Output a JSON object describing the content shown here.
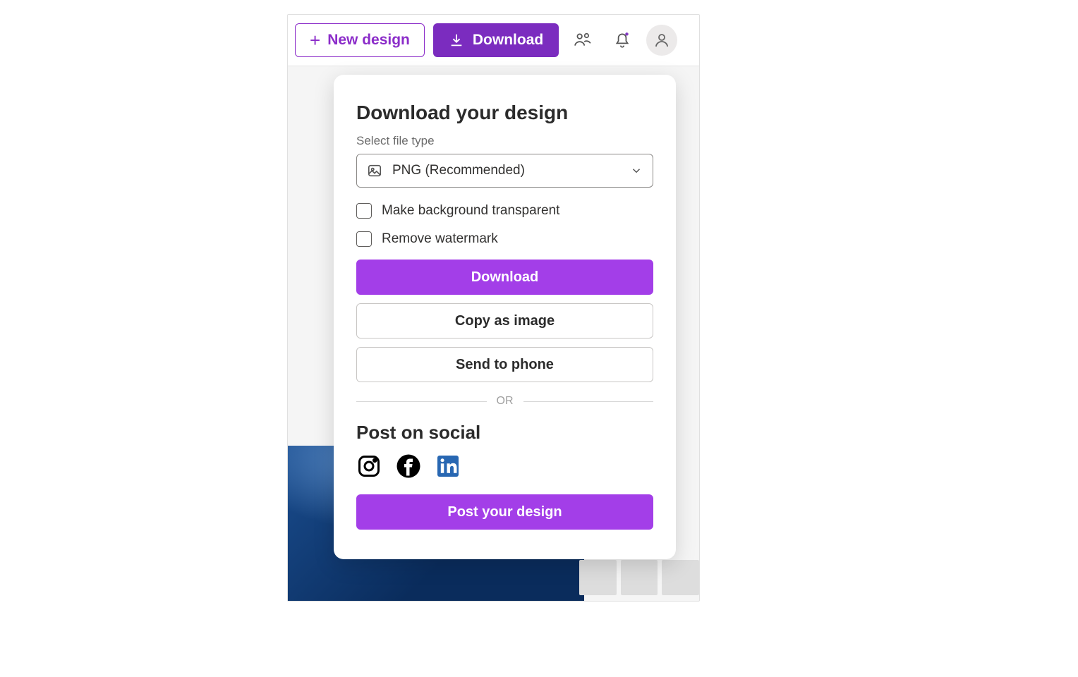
{
  "toolbar": {
    "new_design_label": "New design",
    "download_label": "Download"
  },
  "panel": {
    "title": "Download your design",
    "file_type_label": "Select file type",
    "file_type_value": "PNG (Recommended)",
    "checkbox_transparent": "Make background transparent",
    "checkbox_watermark": "Remove watermark",
    "download_btn": "Download",
    "copy_btn": "Copy as image",
    "send_btn": "Send to phone",
    "divider_text": "OR",
    "social_title": "Post on social",
    "post_btn": "Post your design"
  },
  "colors": {
    "brand_purple": "#7b2cbf",
    "accent_purple": "#a33ee8"
  }
}
